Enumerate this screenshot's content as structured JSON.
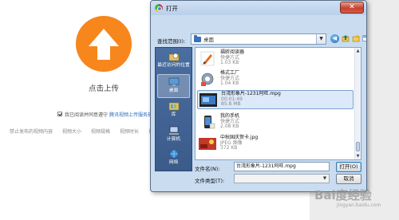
{
  "page": {
    "upload_label": "点击上传",
    "agree_text": "我已阅读并同意遵守",
    "agree_link": "腾讯视频上传服务规则",
    "notices": [
      "禁止发布的视频内容",
      "视频大小",
      "视频规格",
      "视频时长",
      "视频"
    ]
  },
  "dialog": {
    "title": "打开",
    "close_symbol": "✕",
    "look_in_label": "查找范围(I):",
    "look_in_value": "桌面",
    "places": [
      {
        "label": "最近访问的位置",
        "icon": "recent-places-icon"
      },
      {
        "label": "桌面",
        "icon": "desktop-icon",
        "selected": true
      },
      {
        "label": "库",
        "icon": "libraries-icon"
      },
      {
        "label": "计算机",
        "icon": "computer-icon"
      },
      {
        "label": "网络",
        "icon": "network-icon"
      }
    ],
    "files": [
      {
        "name": "福昕阅读器",
        "line2": "快捷方式",
        "line3": "1.03 KB"
      },
      {
        "name": "格式工厂",
        "line2": "快捷方式",
        "line3": "1.04 KB"
      },
      {
        "name": "台湾形象片-1231阿旺.mpg",
        "line2": "00:01:49",
        "line3": "85.8 MB",
        "selected": true
      },
      {
        "name": "我的手机",
        "line2": "快捷方式",
        "line3": "2.08 KB"
      },
      {
        "name": "中秋国庆贺卡.jpg",
        "line2": "JPEG 图像",
        "line3": "372 KB"
      }
    ],
    "filename_label": "文件名(N):",
    "filename_value": "台湾形象片-1231阿旺.mpg",
    "filetype_label": "文件类型(T):",
    "filetype_value": "",
    "open_label": "打开(O)",
    "cancel_label": "取消"
  },
  "watermark": {
    "text": "Bai度经验",
    "sub": "jingyan.baidu.com"
  },
  "colors": {
    "brand_orange": "#f7861d",
    "selection_blue": "#dce9f9",
    "link_blue": "#2b6bbf"
  }
}
